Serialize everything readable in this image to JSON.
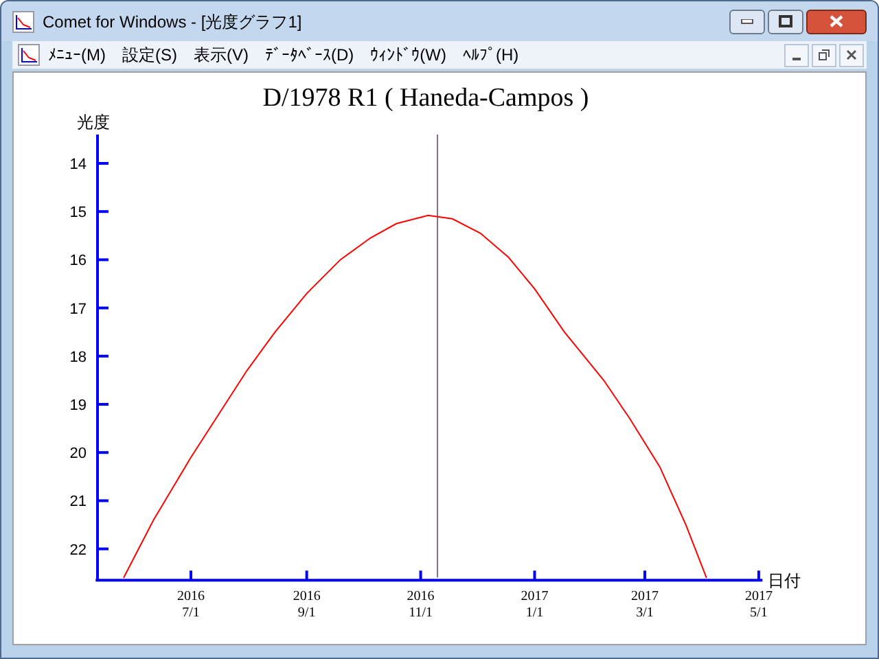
{
  "window": {
    "title": "Comet for Windows - [光度グラフ1]"
  },
  "menu": [
    "ﾒﾆｭｰ(M)",
    "設定(S)",
    "表示(V)",
    "ﾃﾞｰﾀﾍﾞｰｽ(D)",
    "ｳｨﾝﾄﾞｳ(W)",
    "ﾍﾙﾌﾟ(H)"
  ],
  "chart_data": {
    "type": "line",
    "title": "D/1978 R1 ( Haneda-Campos )",
    "xlabel": "日付",
    "ylabel": "光度",
    "x": [
      "2016-05-26",
      "2016-06-11",
      "2016-07-01",
      "2016-07-16",
      "2016-07-31",
      "2016-08-15",
      "2016-09-01",
      "2016-09-19",
      "2016-10-05",
      "2016-10-19",
      "2016-11-05",
      "2016-11-18",
      "2016-12-03",
      "2016-12-18",
      "2017-01-01",
      "2017-01-17",
      "2017-02-07",
      "2017-02-21",
      "2017-03-09",
      "2017-03-23",
      "2017-04-03"
    ],
    "series": [
      {
        "color": "#ff0000",
        "values": [
          22.6,
          21.4,
          20.1,
          19.2,
          18.3,
          17.5,
          16.7,
          16.0,
          15.55,
          15.25,
          15.08,
          15.15,
          15.45,
          15.95,
          16.6,
          17.5,
          18.5,
          19.3,
          20.3,
          21.5,
          22.6
        ]
      }
    ],
    "xlim": [
      "2016-05-11",
      "2017-05-03"
    ],
    "ylim": [
      22.65,
      13.4
    ],
    "yticks": [
      14,
      15,
      16,
      17,
      18,
      19,
      20,
      21,
      22
    ],
    "xticks": [
      {
        "value": "2016-07-01",
        "label": "2016 7/1"
      },
      {
        "value": "2016-09-01",
        "label": "2016 9/1"
      },
      {
        "value": "2016-11-01",
        "label": "2016 11/1"
      },
      {
        "value": "2017-01-01",
        "label": "2017 1/1"
      },
      {
        "value": "2017-03-01",
        "label": "2017 3/1"
      },
      {
        "value": "2017-05-01",
        "label": "2017 5/1"
      }
    ],
    "ref_lines": [
      {
        "axis": "x",
        "value": "2016-11-10"
      }
    ]
  }
}
